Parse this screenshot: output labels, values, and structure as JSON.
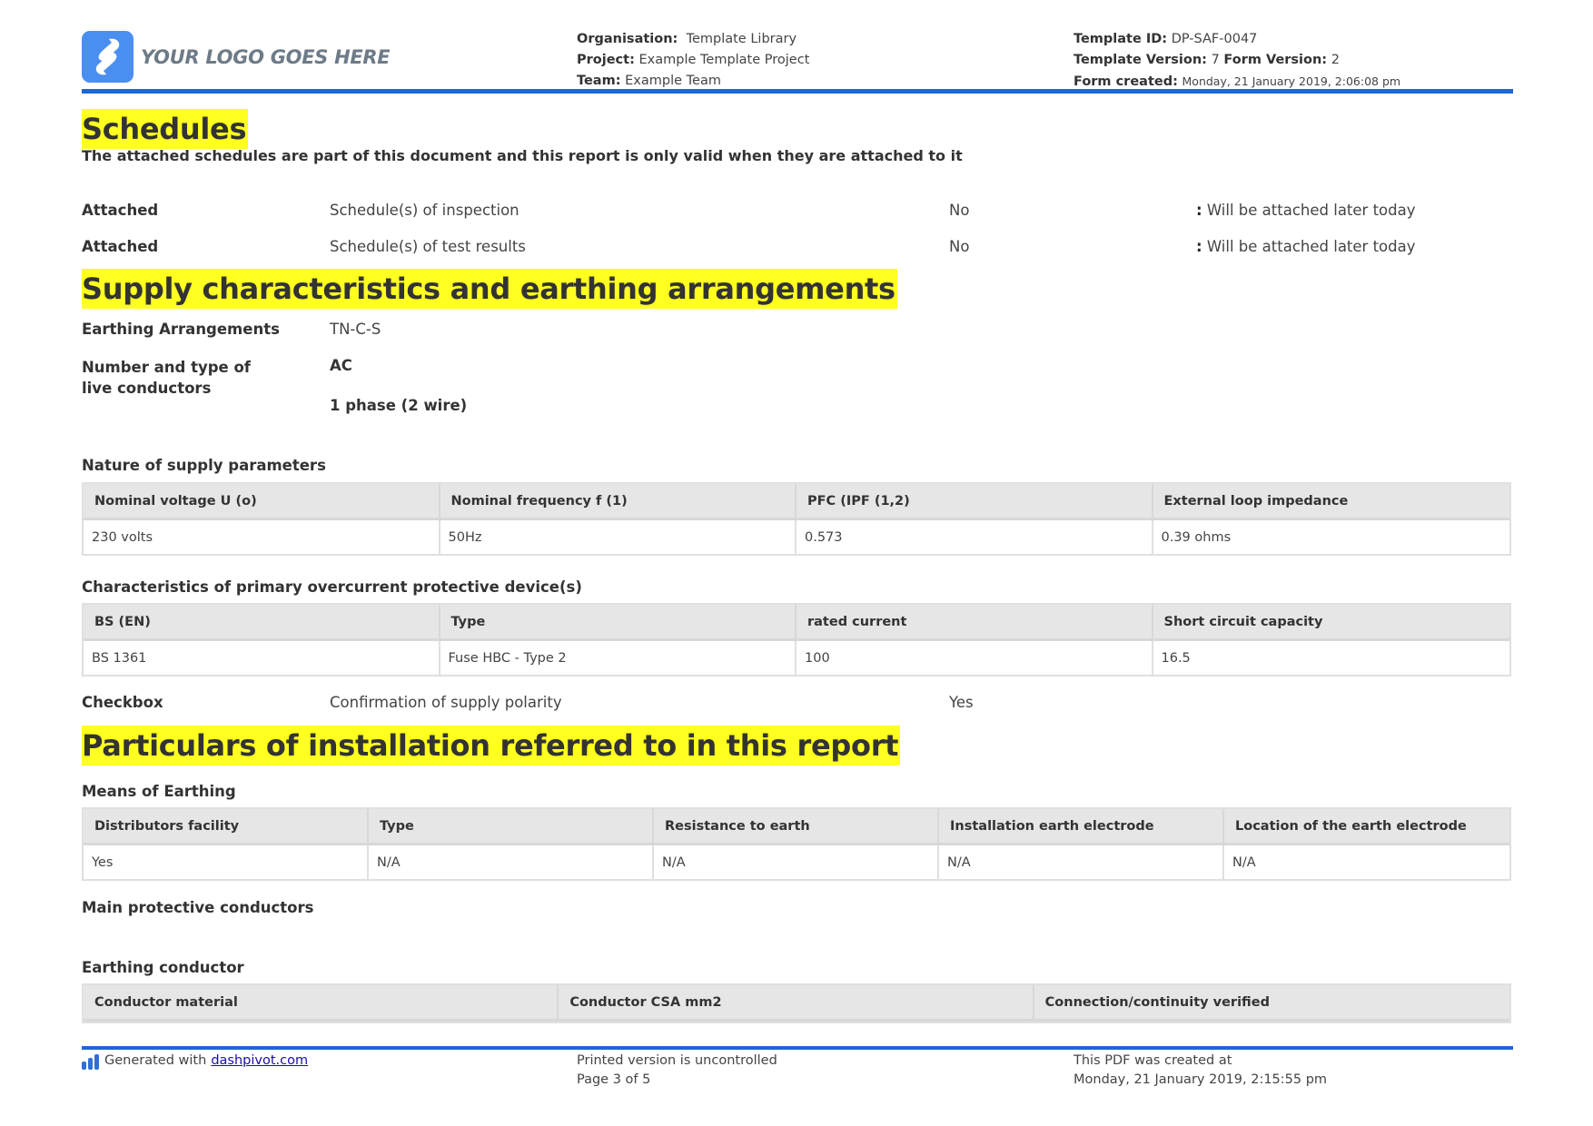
{
  "header": {
    "logo_text": "YOUR LOGO GOES HERE",
    "organisation_label": "Organisation:",
    "organisation_value": "Template Library",
    "project_label": "Project:",
    "project_value": "Example Template Project",
    "team_label": "Team:",
    "team_value": "Example Team",
    "template_id_label": "Template ID:",
    "template_id_value": "DP-SAF-0047",
    "template_version_label": "Template Version:",
    "template_version_value": "7",
    "form_version_label": "Form Version:",
    "form_version_value": "2",
    "form_created_label": "Form created:",
    "form_created_value": "Monday, 21 January 2019, 2:06:08 pm"
  },
  "schedules": {
    "title": "Schedules",
    "lead": "The attached schedules are part of this document and this report is only valid when they are attached to it",
    "rows": [
      {
        "label": "Attached",
        "item": "Schedule(s) of inspection",
        "value": "No",
        "note_prefix": ":",
        "note": "Will be attached later today"
      },
      {
        "label": "Attached",
        "item": "Schedule(s) of test results",
        "value": "No",
        "note_prefix": ":",
        "note": "Will be attached later today"
      }
    ]
  },
  "supply": {
    "title": "Supply characteristics and earthing arrangements",
    "earthing_label": "Earthing Arrangements",
    "earthing_value": "TN-C-S",
    "live_conductors_label": "Number and type of live conductors",
    "live_conductors_value_1": "AC",
    "live_conductors_value_2": "1 phase (2 wire)",
    "nature_title": "Nature of supply parameters",
    "nature_table": {
      "headers": [
        "Nominal voltage U (o)",
        "Nominal frequency f (1)",
        "PFC (IPF (1,2)",
        "External loop impedance"
      ],
      "rows": [
        [
          "230 volts",
          "50Hz",
          "0.573",
          "0.39 ohms"
        ]
      ]
    },
    "overcurrent_title": "Characteristics of primary overcurrent protective device(s)",
    "overcurrent_table": {
      "headers": [
        "BS (EN)",
        "Type",
        "rated current",
        "Short circuit capacity"
      ],
      "rows": [
        [
          "BS 1361",
          "Fuse HBC - Type 2",
          "100",
          "16.5"
        ]
      ]
    },
    "checkbox_label": "Checkbox",
    "checkbox_item": "Confirmation of supply polarity",
    "checkbox_value": "Yes"
  },
  "installation": {
    "title": "Particulars of installation referred to in this report",
    "means_title": "Means of Earthing",
    "means_table": {
      "headers": [
        "Distributors facility",
        "Type",
        "Resistance to earth",
        "Installation earth electrode",
        "Location of the earth electrode"
      ],
      "rows": [
        [
          "Yes",
          "N/A",
          "N/A",
          "N/A",
          "N/A"
        ]
      ]
    },
    "main_protective_title": "Main protective conductors",
    "earthing_conductor_title": "Earthing conductor",
    "earthing_conductor_table": {
      "headers": [
        "Conductor material",
        "Conductor CSA mm2",
        "Connection/continuity verified"
      ]
    }
  },
  "footer": {
    "generated_text": "Generated with",
    "generated_link": "dashpivot.com",
    "uncontrolled": "Printed version is uncontrolled",
    "page_info": "Page 3 of 5",
    "created_label": "This PDF was created at",
    "created_value": "Monday, 21 January 2019, 2:15:55 pm"
  }
}
